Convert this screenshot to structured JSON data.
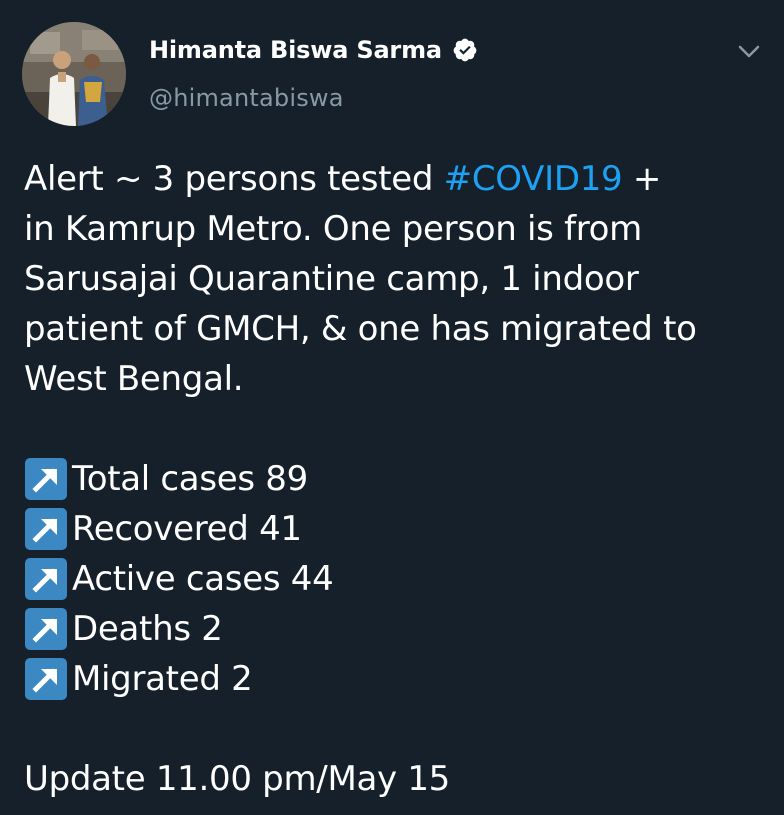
{
  "author": {
    "name": "Himanta Biswa Sarma",
    "handle": "@himantabiswa",
    "verified": true
  },
  "tweet": {
    "line1_prefix": "Alert ~ 3 persons tested ",
    "hashtag": "#COVID19",
    "line1_suffix": " +",
    "line2": "in Kamrup Metro. One person is from",
    "line3": "Sarusajai Quarantine camp, 1 indoor",
    "line4": "patient of GMCH, & one has migrated to",
    "line5": "West Bengal.",
    "stats": [
      {
        "icon": "north-east-arrow-icon",
        "text": "Total cases 89"
      },
      {
        "icon": "north-east-arrow-icon",
        "text": "Recovered 41"
      },
      {
        "icon": "north-east-arrow-icon",
        "text": "Active cases 44"
      },
      {
        "icon": "north-east-arrow-icon",
        "text": "Deaths 2"
      },
      {
        "icon": "north-east-arrow-icon",
        "text": "Migrated 2"
      }
    ],
    "update": "Update 11.00 pm/May 15"
  },
  "colors": {
    "background": "#15202b",
    "text": "#ffffff",
    "secondary_text": "#8899a6",
    "hashtag": "#1da1f2",
    "emoji_box": "#3b88c3"
  }
}
